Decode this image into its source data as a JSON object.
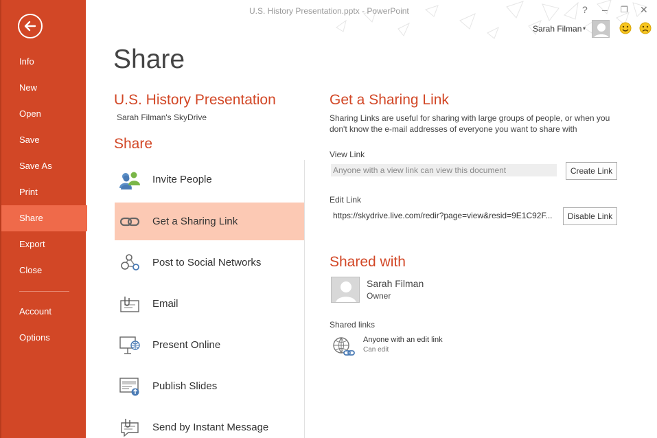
{
  "window": {
    "title": "U.S. History Presentation.pptx - PowerPoint",
    "help": "?",
    "minimize": "–",
    "restore": "❐",
    "close": "✕",
    "user_name": "Sarah Filman",
    "user_caret": "▾"
  },
  "nav": {
    "items": [
      {
        "label": "Info"
      },
      {
        "label": "New"
      },
      {
        "label": "Open"
      },
      {
        "label": "Save"
      },
      {
        "label": "Save As"
      },
      {
        "label": "Print"
      },
      {
        "label": "Share"
      },
      {
        "label": "Export"
      },
      {
        "label": "Close"
      },
      {
        "label": "Account"
      },
      {
        "label": "Options"
      }
    ],
    "selected": "Share"
  },
  "main": {
    "page_title": "Share",
    "doc_title": "U.S. History Presentation",
    "doc_location": "Sarah Filman's SkyDrive",
    "share_heading": "Share",
    "options": [
      {
        "label": "Invite People",
        "icon": "invite-people-icon"
      },
      {
        "label": "Get a Sharing Link",
        "icon": "sharing-link-icon"
      },
      {
        "label": "Post to Social Networks",
        "icon": "social-networks-icon"
      },
      {
        "label": "Email",
        "icon": "email-icon"
      },
      {
        "label": "Present Online",
        "icon": "present-online-icon"
      },
      {
        "label": "Publish Slides",
        "icon": "publish-slides-icon"
      },
      {
        "label": "Send by Instant Message",
        "icon": "instant-message-icon"
      }
    ],
    "selected_option": "Get a Sharing Link"
  },
  "panel": {
    "heading": "Get a Sharing Link",
    "description": "Sharing Links are useful for sharing with large groups of people, or when you don't know the e-mail addresses of everyone you want to share with",
    "view_link": {
      "label": "View Link",
      "placeholder": "Anyone with a view link can view this document",
      "button": "Create Link"
    },
    "edit_link": {
      "label": "Edit Link",
      "value": "https://skydrive.live.com/redir?page=view&resid=9E1C92F...",
      "button": "Disable Link"
    },
    "shared_with": {
      "heading": "Shared with",
      "owner_name": "Sarah Filman",
      "owner_role": "Owner",
      "shared_links_label": "Shared links",
      "link_title": "Anyone with an edit link",
      "link_permission": "Can edit"
    }
  },
  "colors": {
    "accent": "#d24726",
    "nav_selected": "#ef6a4a",
    "option_selected": "#fcc9b4"
  }
}
